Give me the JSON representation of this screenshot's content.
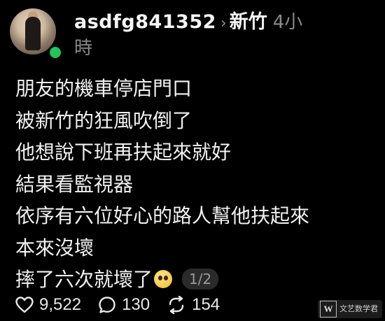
{
  "header": {
    "username": "asdfg841352",
    "chevron": "›",
    "location": "新竹",
    "time": "4小時"
  },
  "post": {
    "lines": [
      "朋友的機車停店門口",
      "被新竹的狂風吹倒了",
      "他想說下班再扶起來就好",
      "結果看監視器",
      "依序有六位好心的路人幫他扶起來",
      "本來沒壞",
      "摔了六次就壞了"
    ],
    "emoji": "pleading-face-emoji",
    "page_indicator": "1/2"
  },
  "actions": {
    "likes": "9,522",
    "comments": "130",
    "reposts": "154"
  },
  "icons": {
    "like": "heart-icon",
    "comment": "comment-bubble-icon",
    "repost": "repost-icon"
  },
  "watermark": {
    "logo": "W",
    "text": "文艺数学君"
  },
  "colors": {
    "background": "#000000",
    "text": "#f2f2f2",
    "muted": "#8a8a8a",
    "online": "#22c55e",
    "badge_bg": "#2a2a2a"
  }
}
